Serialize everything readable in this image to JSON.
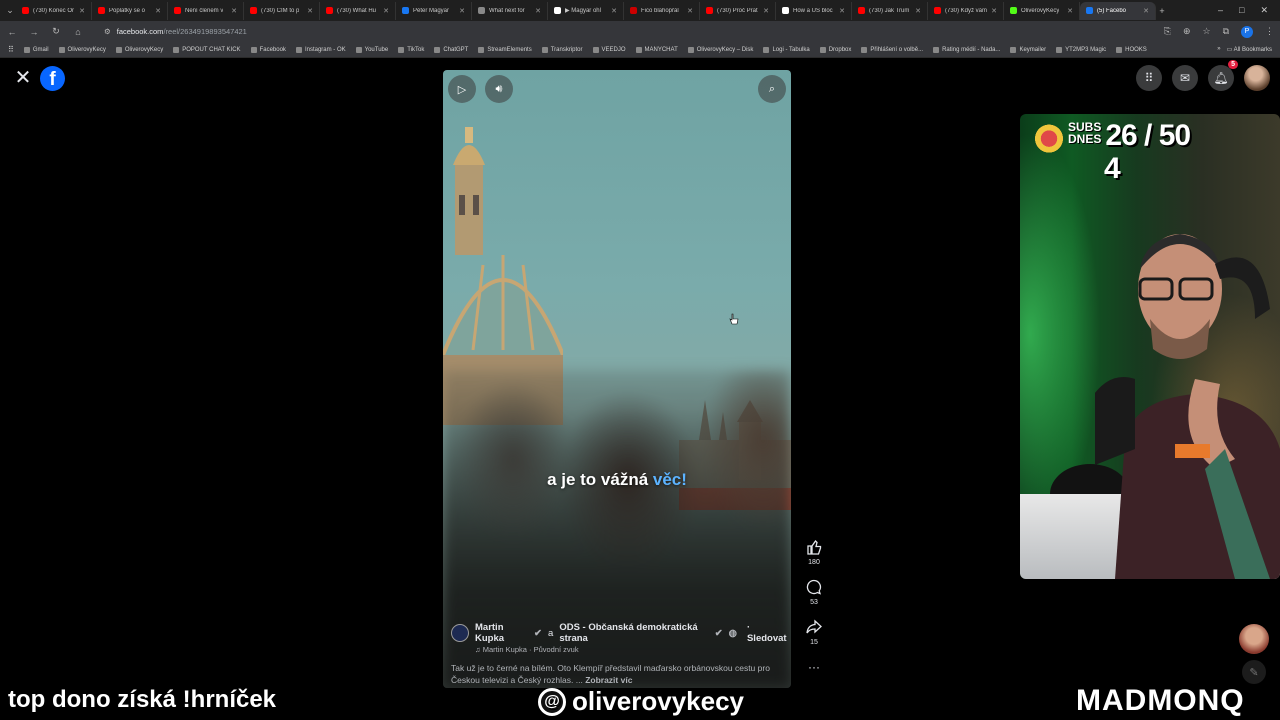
{
  "browser": {
    "tabs": [
      {
        "label": "(730) Konec Or",
        "color": "#ff0000"
      },
      {
        "label": "Poplatky se o",
        "color": "#ff0000"
      },
      {
        "label": "Není členem v",
        "color": "#ff0000"
      },
      {
        "label": "(730) ČÍM to p",
        "color": "#ff0000"
      },
      {
        "label": "(730) What Hu",
        "color": "#ff0000"
      },
      {
        "label": "Péter Magyar",
        "color": "#1877f2"
      },
      {
        "label": "What next for",
        "color": "#888888"
      },
      {
        "label": "▶ Magyar ohl",
        "color": "#ffffff"
      },
      {
        "label": "Fico blahopřál",
        "color": "#cc0000"
      },
      {
        "label": "(730) Proč Prat",
        "color": "#ff0000"
      },
      {
        "label": "How a US bloc",
        "color": "#ffffff"
      },
      {
        "label": "(730) Jak Trum",
        "color": "#ff0000"
      },
      {
        "label": "(730) Když vám",
        "color": "#ff0000"
      },
      {
        "label": "OliverovyKecy",
        "color": "#53fc18"
      },
      {
        "label": "(5) Facebo",
        "color": "#1877f2",
        "active": true
      }
    ],
    "url_host": "facebook.com",
    "url_path": "/reel/2634919893547421",
    "bookmarks": [
      "Gmail",
      "OliverovyKecy",
      "OliverovyKecy",
      "POPOUT CHAT KICK",
      "Facebook",
      "Instagram - OK",
      "YouTube",
      "TikTok",
      "ChatGPT",
      "StreamElements",
      "Transkriptor",
      "VEEDJO",
      "MANYCHAT",
      "OliverovyKecy – Disk",
      "Logi - Tabulka",
      "Dropbox",
      "Přihlášení o volbě...",
      "Rating médií - Nada...",
      "Keymailer",
      "YT2MP3 Magic",
      "HOOKS"
    ],
    "all_bookmarks": "All Bookmarks"
  },
  "facebook": {
    "notifications_badge": "5",
    "reel": {
      "subtitle_main": "a je to vážná ",
      "subtitle_highlight": "věc!",
      "author": "Martin Kupka",
      "coauthor_joiner": "a",
      "coauthor": "ODS - Občanská demokratická strana",
      "follow": "· Sledovat",
      "audio": "Martin Kupka · Původní zvuk",
      "description": "Tak už je to černé na bílém. Oto Klempíř představil maďarsko orbánovskou cestu pro Českou televizi a Český rozhlas. ...",
      "see_more": "Zobrazit víc"
    },
    "actions": {
      "likes": "180",
      "comments": "53",
      "shares": "15"
    }
  },
  "stream": {
    "subs_label_1": "SUBS",
    "subs_label_2": "DNES",
    "subs_count": "26 / 50",
    "subs_extra": "4",
    "overlay_left": "top dono získá !hrníček",
    "overlay_center": "oliverovykecy",
    "overlay_right": "MADMONQ"
  }
}
